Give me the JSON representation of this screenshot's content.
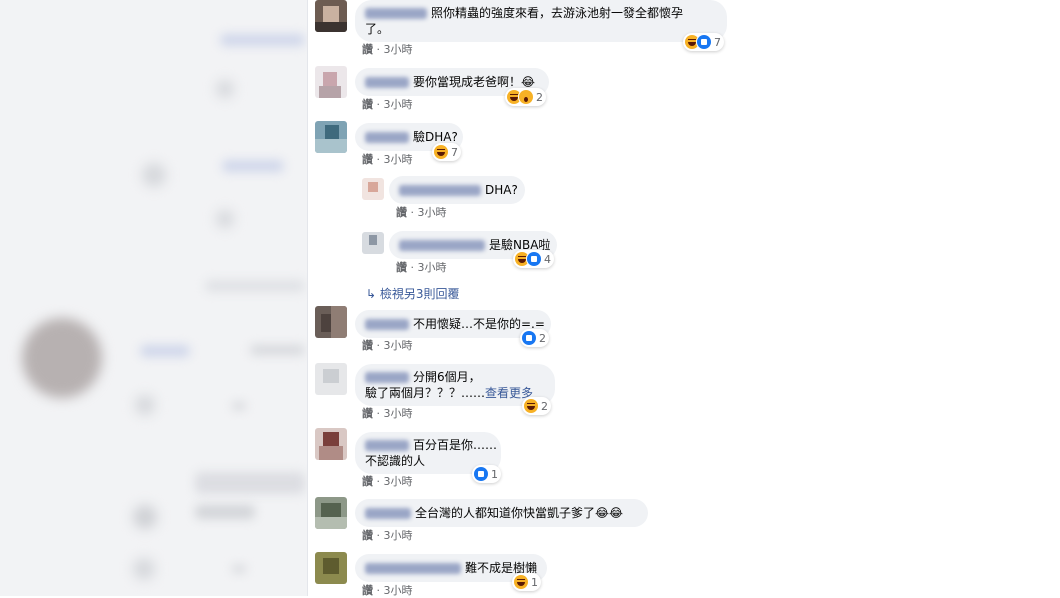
{
  "comments": [
    {
      "text": "照你精蟲的強度來看，去游泳池射一發全都懷孕",
      "text2": "了。",
      "like": "讚",
      "time": "3小時",
      "count": "7"
    },
    {
      "text": "要你當現成老爸啊！😂",
      "like": "讚",
      "time": "3小時",
      "count": "2"
    },
    {
      "text": "驗DHA?",
      "like": "讚",
      "time": "3小時",
      "count": "7"
    },
    {
      "text": "DHA?",
      "like": "讚",
      "time": "3小時"
    },
    {
      "text": "是驗NBA啦",
      "like": "讚",
      "time": "3小時",
      "count": "4"
    },
    {
      "text": "不用懷疑…不是你的=.=",
      "like": "讚",
      "time": "3小時",
      "count": "2"
    },
    {
      "text": "分開6個月，",
      "text2": "驗了兩個月？？？……",
      "see_more": "查看更多",
      "like": "讚",
      "time": "3小時",
      "count": "2"
    },
    {
      "text": "百分百是你……",
      "text2": "不認識的人",
      "like": "讚",
      "time": "3小時",
      "count": "1"
    },
    {
      "text": "全台灣的人都知道你快當凱子爹了😂😂",
      "like": "讚",
      "time": "3小時"
    },
    {
      "text": "難不成是樹懶",
      "like": "讚",
      "time": "3小時",
      "count": "1"
    }
  ],
  "view_more_replies": "↳  檢視另3則回覆",
  "colors": {
    "bubble": "#f0f2f5",
    "link": "#385898",
    "meta": "#65676b",
    "like_blue": "#1877f2",
    "haha": "#f7b125"
  }
}
